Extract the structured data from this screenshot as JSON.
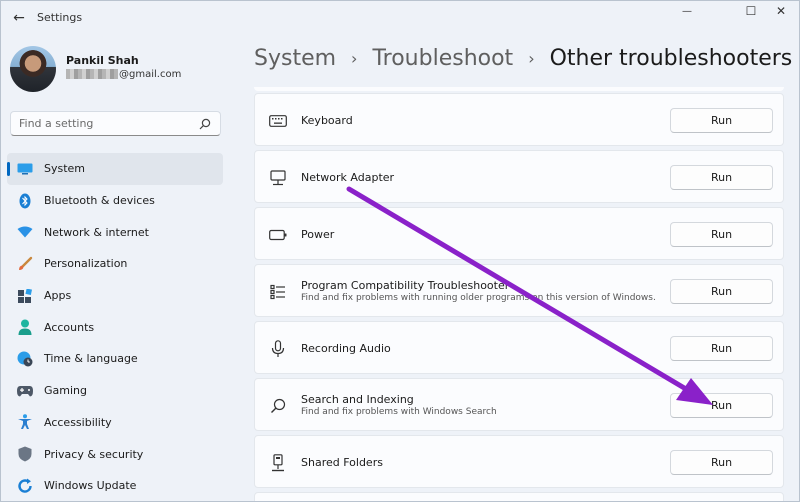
{
  "window": {
    "title": "Settings",
    "back_glyph": "←",
    "min_glyph": "—",
    "max_glyph": "☐",
    "close_glyph": "✕"
  },
  "profile": {
    "name": "Pankil Shah",
    "email_suffix": "@gmail.com"
  },
  "search": {
    "placeholder": "Find a setting",
    "icon": "search-icon"
  },
  "nav": {
    "items": [
      {
        "label": "System",
        "icon": "system-icon",
        "selected": true
      },
      {
        "label": "Bluetooth & devices",
        "icon": "bluetooth-icon"
      },
      {
        "label": "Network & internet",
        "icon": "wifi-icon"
      },
      {
        "label": "Personalization",
        "icon": "brush-icon"
      },
      {
        "label": "Apps",
        "icon": "apps-icon"
      },
      {
        "label": "Accounts",
        "icon": "account-icon"
      },
      {
        "label": "Time & language",
        "icon": "globe-clock-icon"
      },
      {
        "label": "Gaming",
        "icon": "gaming-icon"
      },
      {
        "label": "Accessibility",
        "icon": "accessibility-icon"
      },
      {
        "label": "Privacy & security",
        "icon": "shield-icon"
      },
      {
        "label": "Windows Update",
        "icon": "update-icon"
      }
    ]
  },
  "breadcrumb": {
    "items": [
      "System",
      "Troubleshoot",
      "Other troubleshooters"
    ],
    "separator": "›"
  },
  "troubleshooters": [
    {
      "title": "Keyboard",
      "description": "",
      "icon": "keyboard-icon",
      "button": "Run"
    },
    {
      "title": "Network Adapter",
      "description": "",
      "icon": "network-adapter-icon",
      "button": "Run"
    },
    {
      "title": "Power",
      "description": "",
      "icon": "battery-icon",
      "button": "Run"
    },
    {
      "title": "Program Compatibility Troubleshooter",
      "description": "Find and fix problems with running older programs on this version of Windows.",
      "icon": "list-icon",
      "button": "Run"
    },
    {
      "title": "Recording Audio",
      "description": "",
      "icon": "microphone-icon",
      "button": "Run"
    },
    {
      "title": "Search and Indexing",
      "description": "Find and fix problems with Windows Search",
      "icon": "search-icon",
      "button": "Run"
    },
    {
      "title": "Shared Folders",
      "description": "",
      "icon": "shared-folder-icon",
      "button": "Run"
    }
  ],
  "colors": {
    "accent": "#0067c0",
    "annotation_arrow": "#8a21c9"
  }
}
